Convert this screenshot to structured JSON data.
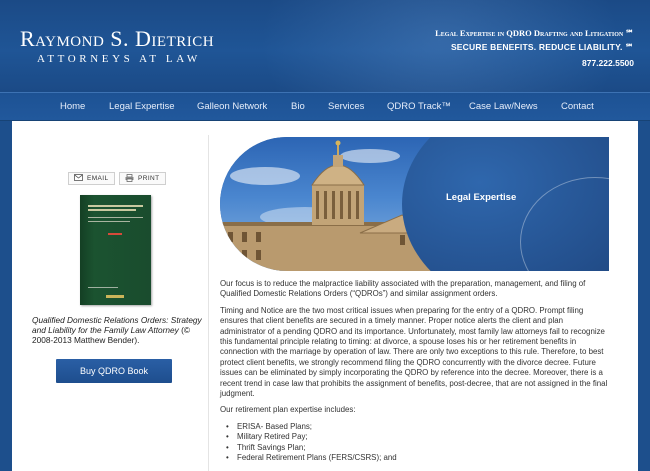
{
  "header": {
    "firm_name": "Raymond S. Dietrich",
    "firm_subtitle": "ATTORNEYS AT LAW",
    "tagline_1": "Legal Expertise in QDRO Drafting and Litigation ℠",
    "tagline_2": "SECURE BENEFITS. REDUCE LIABILITY. ℠",
    "phone": "877.222.5500"
  },
  "nav": {
    "items": [
      {
        "label": "Home"
      },
      {
        "label": "Legal Expertise"
      },
      {
        "label": "Galleon Network"
      },
      {
        "label": "Bio"
      },
      {
        "label": "Services"
      },
      {
        "label": "QDRO Track™"
      },
      {
        "label": "Case Law/News"
      },
      {
        "label": "Contact"
      }
    ]
  },
  "sidebar": {
    "email_label": "EMAIL",
    "print_label": "PRINT",
    "caption_italic": "Qualified Domestic Relations Orders: Strategy and Liability for the Family Law Attorney",
    "caption_rest": " (© 2008-2013 Matthew Bender).",
    "buy_button": "Buy QDRO Book"
  },
  "banner": {
    "title": "Legal Expertise"
  },
  "main": {
    "paragraph_1": "Our focus is to reduce the malpractice liability associated with the preparation, management, and filing of Qualified Domestic Relations Orders (“QDROs”) and similar assignment orders.",
    "paragraph_2": "Timing and Notice are the two most critical issues when preparing for the entry of a QDRO. Prompt filing ensures that client benefits are secured in a timely manner. Proper notice alerts the client and plan administrator of a pending QDRO and its importance. Unfortunately, most family law attorneys fail to recognize this fundamental principle relating to timing: at divorce, a spouse loses his or her retirement benefits in connection with the marriage by operation of law. There are only two exceptions to this rule. Therefore, to best protect client benefits, we strongly recommend filing the QDRO concurrently with the divorce decree. Future issues can be eliminated by simply incorporating the QDRO by reference into the decree. Moreover, there is a recent trend in case law that prohibits the assignment of benefits, post-decree, that are not assigned in the final judgment.",
    "list_intro": "Our retirement plan expertise includes:",
    "list_items": [
      "ERISA- Based Plans;",
      "Military Retired Pay;",
      "Thrift Savings Plan;",
      "Federal Retirement Plans (FERS/CSRS); and"
    ]
  },
  "colors": {
    "brand_blue": "#1d4f8c",
    "button_blue": "#2a5fa5",
    "book_green": "#1a4c2e"
  }
}
